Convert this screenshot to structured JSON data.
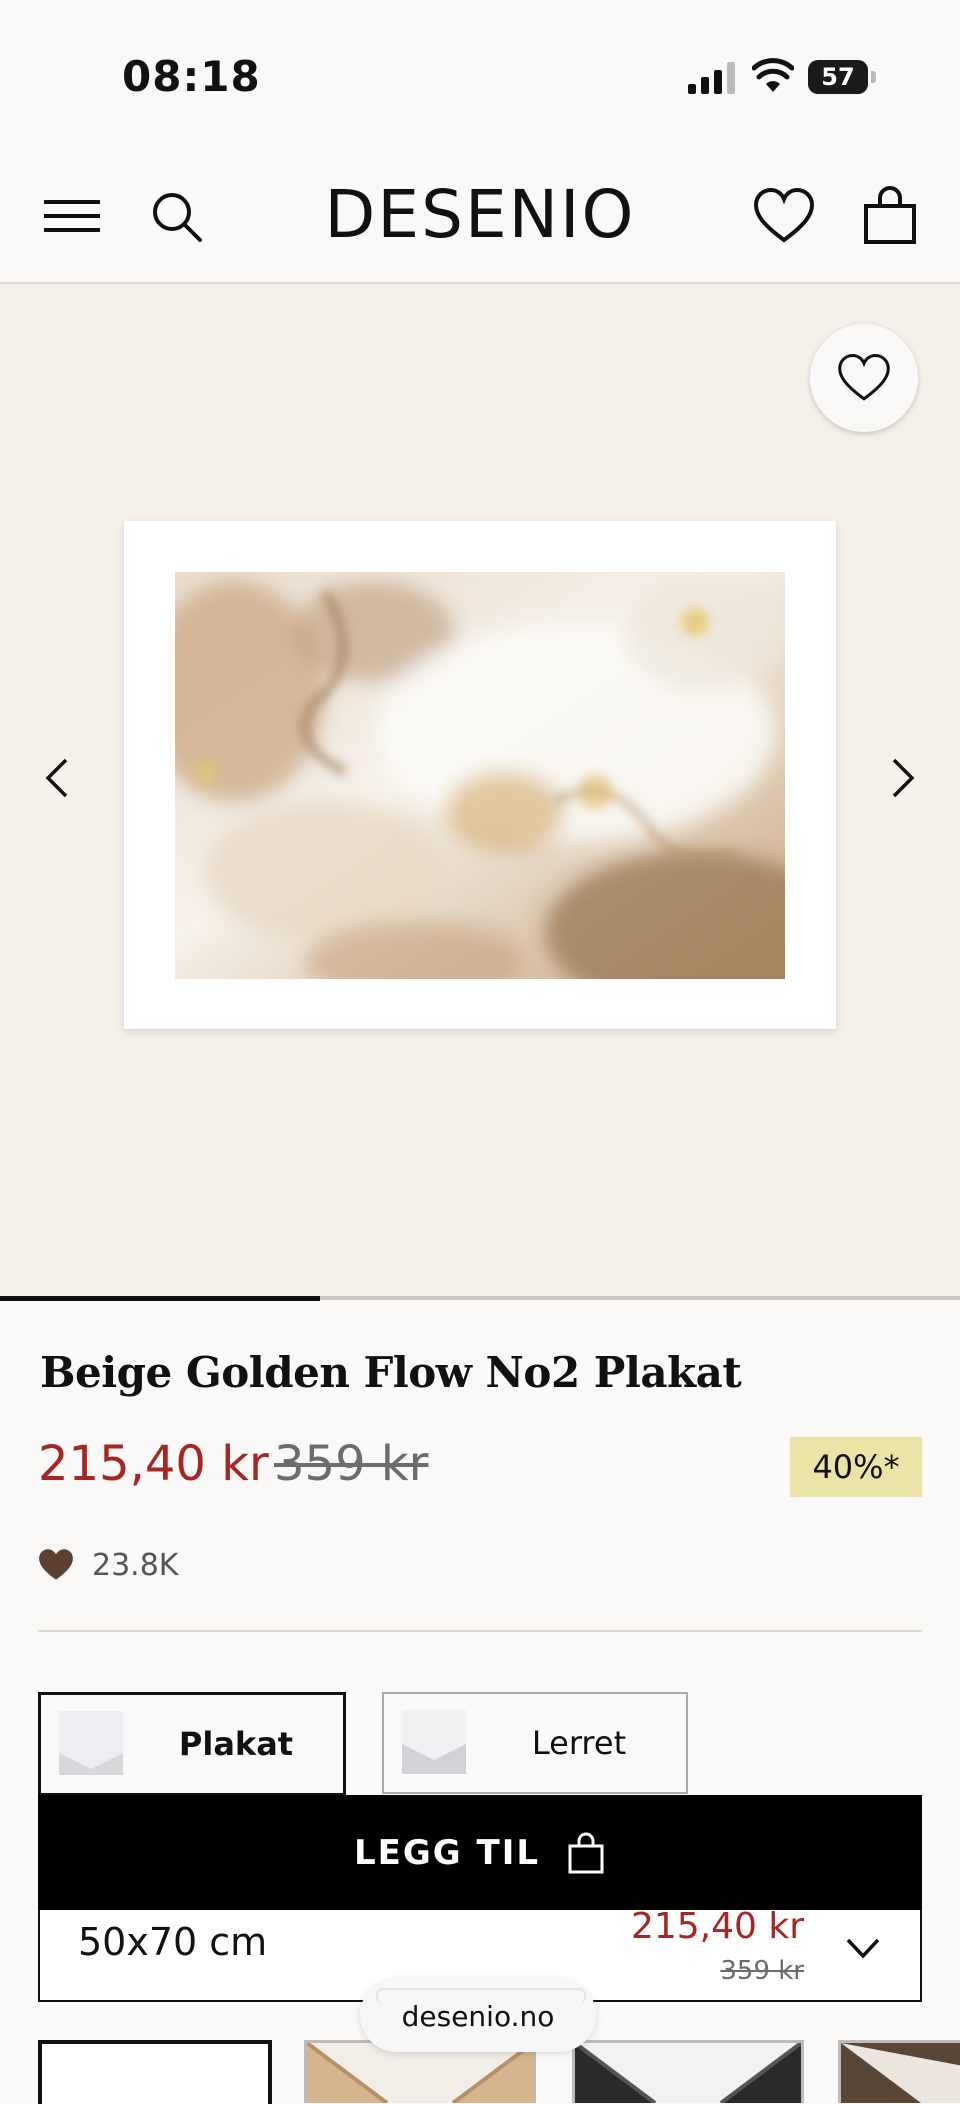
{
  "status_bar": {
    "time": "08:18",
    "battery": "57"
  },
  "header": {
    "logo": "DESENIO"
  },
  "product": {
    "title": "Beige Golden Flow No2 Plakat",
    "price": "215,40 kr",
    "old_price": "359 kr",
    "discount": "40%*",
    "likes": "23.8K"
  },
  "options": {
    "material": [
      {
        "label": "Plakat",
        "selected": true
      },
      {
        "label": "Lerret",
        "selected": false
      }
    ]
  },
  "cart": {
    "label": "LEGG TIL"
  },
  "size": {
    "label": "50x70 cm",
    "price": "215,40 kr",
    "old_price": "359 kr"
  },
  "browser": {
    "url": "desenio.no"
  },
  "colors": {
    "sale_red": "#a52622",
    "discount_bg": "#ece3a6",
    "gallery_bg": "#f5f0e9"
  },
  "icons": [
    "menu-icon",
    "search-icon",
    "heart-icon",
    "bag-icon",
    "chevron-left-icon",
    "chevron-right-icon",
    "chevron-down-icon"
  ]
}
